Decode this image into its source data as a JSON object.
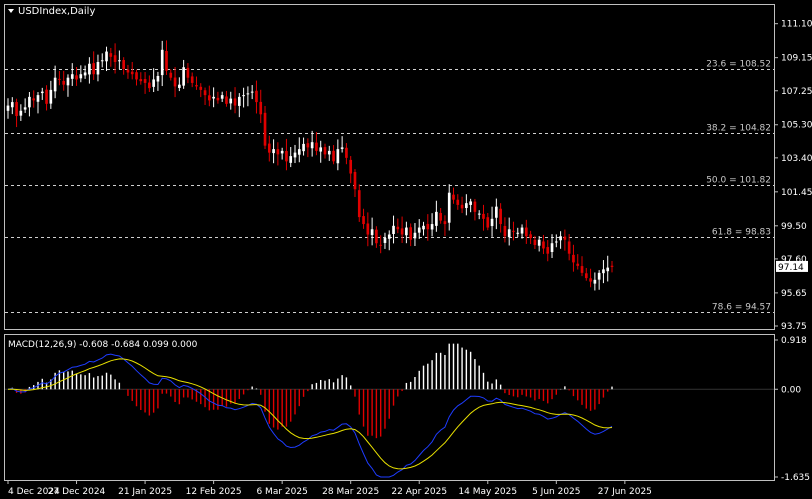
{
  "window": {
    "title": "USDIndex,Daily",
    "menu_icon": "triangle-down-icon"
  },
  "colors": {
    "background": "#000000",
    "frame": "#bfbfbf",
    "bull": "#ffffff",
    "bear": "#e00000",
    "macd_line": "#1e3cff",
    "signal_line": "#e8e000",
    "hist_pos": "#ffffff",
    "hist_neg": "#e00000"
  },
  "chart_data": [
    {
      "type": "candlestick",
      "name": "USDIndex",
      "timeframe": "Daily",
      "ylim": [
        93.75,
        112.0
      ],
      "yticks": [
        111.1,
        109.15,
        107.25,
        105.3,
        103.4,
        101.45,
        99.5,
        97.6,
        95.65,
        93.75
      ],
      "ytick_labels": [
        "111.10",
        "109.15",
        "107.25",
        "105.30",
        "103.40",
        "101.45",
        "99.50",
        "97.60",
        "95.65",
        "93.75"
      ],
      "current_price": 97.14,
      "current_price_label": "97.14",
      "xtick_labels": [
        "4 Dec 2024",
        "27 Dec 2024",
        "21 Jan 2025",
        "12 Feb 2025",
        "6 Mar 2025",
        "28 Mar 2025",
        "22 Apr 2025",
        "14 May 2025",
        "5 Jun 2025",
        "27 Jun 2025"
      ],
      "xtick_index": [
        0,
        16,
        32,
        48,
        64,
        80,
        96,
        112,
        128,
        144
      ],
      "fib_levels": [
        {
          "label": "23.6 = 108.52",
          "value": 108.52
        },
        {
          "label": "38.2 = 104.82",
          "value": 104.82
        },
        {
          "label": "50.0 = 101.82",
          "value": 101.82
        },
        {
          "label": "61.8 = 98.83",
          "value": 98.83
        },
        {
          "label": "78.6 = 94.57",
          "value": 94.57
        }
      ],
      "close": [
        106.4,
        106.6,
        105.8,
        106.1,
        106.3,
        106.9,
        106.7,
        107.0,
        107.2,
        106.5,
        107.3,
        108.0,
        107.9,
        107.6,
        108.0,
        108.2,
        107.9,
        108.2,
        108.3,
        108.8,
        108.2,
        108.9,
        109.0,
        109.5,
        109.2,
        108.9,
        109.0,
        108.5,
        108.3,
        108.2,
        107.9,
        107.8,
        107.7,
        107.4,
        107.9,
        108.1,
        109.6,
        108.4,
        108.0,
        107.5,
        107.6,
        108.6,
        108.0,
        107.7,
        107.5,
        107.3,
        107.0,
        106.7,
        106.9,
        106.7,
        107.0,
        106.5,
        106.8,
        106.4,
        106.9,
        107.0,
        107.1,
        107.2,
        106.6,
        105.9,
        104.1,
        103.7,
        103.9,
        103.6,
        103.8,
        103.2,
        103.5,
        103.7,
        103.9,
        104.2,
        104.0,
        104.3,
        103.8,
        104.0,
        103.6,
        103.8,
        103.2,
        103.9,
        104.0,
        103.4,
        102.5,
        101.6,
        100.0,
        99.6,
        99.0,
        99.3,
        98.5,
        98.4,
        98.8,
        99.0,
        99.5,
        99.3,
        99.0,
        99.4,
        98.7,
        99.1,
        99.4,
        99.5,
        99.3,
        99.6,
        100.3,
        99.8,
        99.6,
        101.4,
        101.0,
        100.7,
        100.5,
        100.8,
        100.9,
        100.3,
        100.2,
        99.9,
        99.4,
        99.9,
        100.6,
        99.6,
        98.9,
        99.3,
        99.2,
        99.1,
        99.4,
        98.9,
        98.8,
        98.4,
        98.7,
        98.2,
        97.9,
        98.5,
        98.6,
        98.9,
        98.7,
        97.9,
        97.4,
        97.2,
        96.8,
        96.5,
        96.3,
        96.4,
        96.8,
        97.0,
        97.1,
        97.14
      ],
      "high_approx": "close + 0.3 to 0.8",
      "low_approx": "close - 0.3 to 0.8"
    },
    {
      "type": "line",
      "name": "MACD(12,26,9)",
      "label": "MACD(12,26,9) -0.608 -0.684 0.099 0.000",
      "values_label": [
        "-0.608",
        "-0.684",
        "0.099",
        "0.000"
      ],
      "ylim": [
        -1.635,
        0.918
      ],
      "ytick_labels": [
        "0.918",
        "0.00",
        "-1.635"
      ],
      "yticks": [
        0.918,
        0.0,
        -1.635
      ]
    }
  ]
}
